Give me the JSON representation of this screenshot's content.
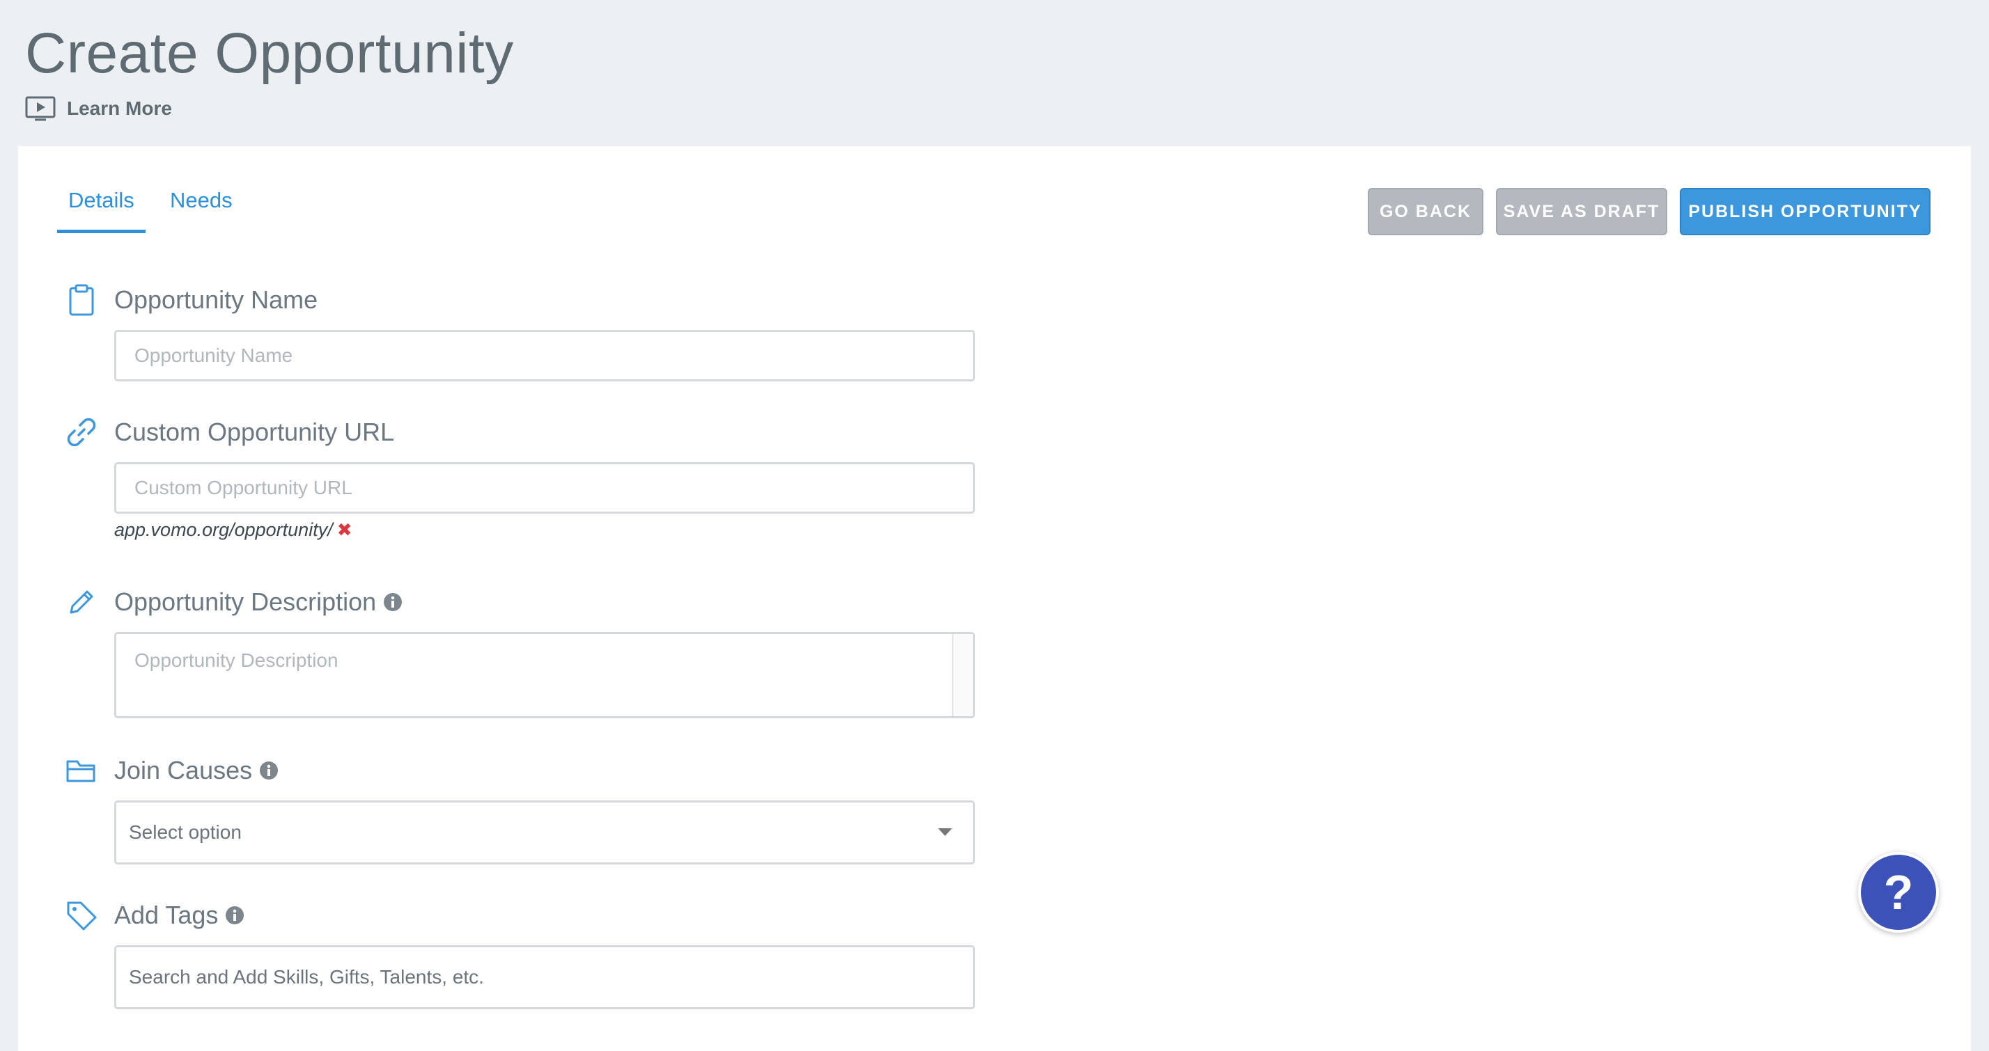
{
  "header": {
    "title": "Create Opportunity",
    "learn_more": "Learn More"
  },
  "tabs": [
    {
      "label": "Details",
      "active": true
    },
    {
      "label": "Needs",
      "active": false
    }
  ],
  "actions": {
    "go_back": "GO BACK",
    "save_draft": "SAVE AS DRAFT",
    "publish": "PUBLISH OPPORTUNITY"
  },
  "fields": {
    "name": {
      "label": "Opportunity Name",
      "placeholder": "Opportunity Name",
      "icon": "clipboard-icon"
    },
    "url": {
      "label": "Custom Opportunity URL",
      "placeholder": "Custom Opportunity URL",
      "hint": "app.vomo.org/opportunity/",
      "hint_status": "✖",
      "icon": "link-icon"
    },
    "description": {
      "label": "Opportunity Description",
      "placeholder": "Opportunity Description",
      "icon": "pencil-icon"
    },
    "causes": {
      "label": "Join Causes",
      "placeholder": "Select option",
      "icon": "folder-icon"
    },
    "tags": {
      "label": "Add Tags",
      "placeholder": "Search and Add Skills, Gifts, Talents, etc.",
      "icon": "tag-icon"
    }
  },
  "help": {
    "label": "?"
  },
  "colors": {
    "accent": "#3c97dc",
    "secondary_button": "#b3b9be",
    "help_button": "#3d52b8",
    "error": "#d9363e",
    "page_background": "#ecf0f3"
  }
}
